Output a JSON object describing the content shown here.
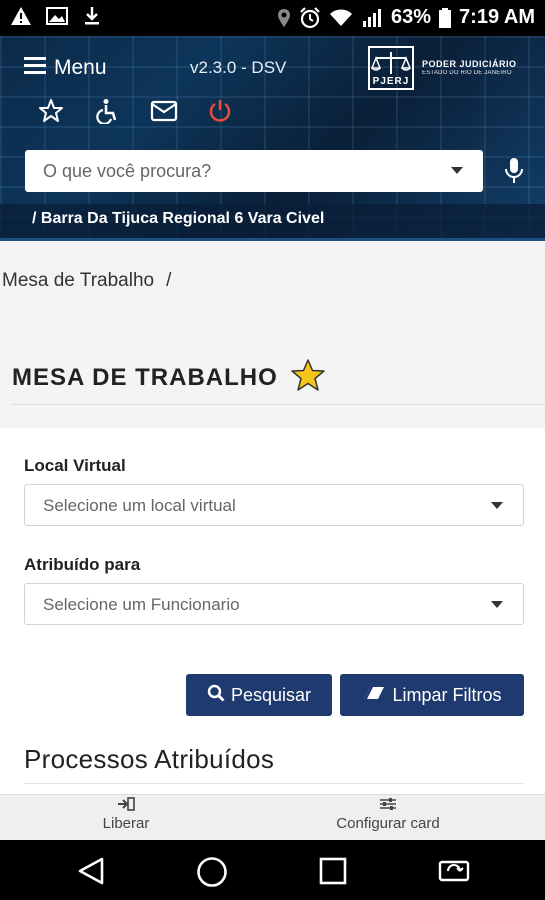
{
  "status_bar": {
    "battery": "63%",
    "time": "7:19 AM"
  },
  "header": {
    "menu_label": "Menu",
    "version": "v2.3.0 - DSV",
    "logo_mark": "PJERJ",
    "logo_line1": "PODER JUDICIÁRIO",
    "logo_line2": "ESTADO DO RIO DE JANEIRO",
    "search_placeholder": "O que você procura?",
    "location": "/ Barra Da Tijuca Regional 6 Vara Civel",
    "colors": {
      "accent": "#1e3a6e",
      "power": "#e74c3c",
      "star": "#f5c518"
    }
  },
  "breadcrumb": {
    "item": "Mesa de Trabalho",
    "separator": "/"
  },
  "page": {
    "title": "MESA DE TRABALHO"
  },
  "form": {
    "local_label": "Local Virtual",
    "local_value": "Selecione um local virtual",
    "atribuido_label": "Atribuído para",
    "atribuido_value": "Selecione um Funcionario",
    "search_button": "Pesquisar",
    "clear_button": "Limpar Filtros",
    "section_title": "Processos Atribuídos"
  },
  "action_bar": {
    "liberar": "Liberar",
    "configurar": "Configurar card"
  },
  "icons": [
    "warning-icon",
    "image-icon",
    "download-icon",
    "location-icon",
    "alarm-icon",
    "wifi-icon",
    "signal-icon",
    "battery-icon",
    "menu-icon",
    "star-icon",
    "accessibility-icon",
    "mail-icon",
    "power-icon",
    "mic-icon",
    "search-icon",
    "eraser-icon",
    "back-icon",
    "home-icon",
    "recents-icon",
    "rotate-icon"
  ]
}
